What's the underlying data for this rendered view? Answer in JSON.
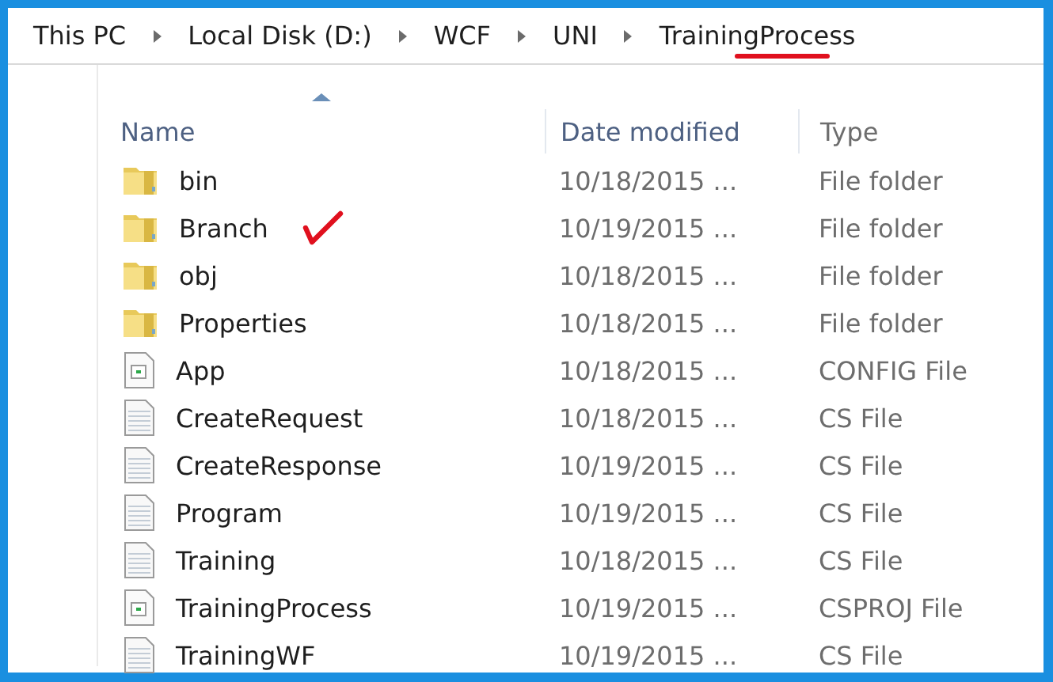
{
  "breadcrumb": [
    {
      "label": "This PC",
      "underlined": false
    },
    {
      "label": "Local Disk (D:)",
      "underlined": false
    },
    {
      "label": "WCF",
      "underlined": false
    },
    {
      "label": "UNI",
      "underlined": false
    },
    {
      "label": "TrainingProcess",
      "underlined": true
    }
  ],
  "columns": [
    {
      "label": "Name",
      "sorted": true
    },
    {
      "label": "Date modified",
      "sorted": false
    },
    {
      "label": "Type",
      "sorted": false
    }
  ],
  "files": [
    {
      "kind": "folder",
      "name": "bin",
      "date": "10/18/2015 ...",
      "type": "File folder",
      "marked": false
    },
    {
      "kind": "folder",
      "name": "Branch",
      "date": "10/19/2015 ...",
      "type": "File folder",
      "marked": true
    },
    {
      "kind": "folder",
      "name": "obj",
      "date": "10/18/2015 ...",
      "type": "File folder",
      "marked": false
    },
    {
      "kind": "folder",
      "name": "Properties",
      "date": "10/18/2015 ...",
      "type": "File folder",
      "marked": false
    },
    {
      "kind": "project",
      "name": "App",
      "date": "10/18/2015 ...",
      "type": "CONFIG File",
      "marked": false
    },
    {
      "kind": "text",
      "name": "CreateRequest",
      "date": "10/18/2015 ...",
      "type": "CS File",
      "marked": false
    },
    {
      "kind": "text",
      "name": "CreateResponse",
      "date": "10/19/2015 ...",
      "type": "CS File",
      "marked": false
    },
    {
      "kind": "text",
      "name": "Program",
      "date": "10/19/2015 ...",
      "type": "CS File",
      "marked": false
    },
    {
      "kind": "text",
      "name": "Training",
      "date": "10/18/2015 ...",
      "type": "CS File",
      "marked": false
    },
    {
      "kind": "project",
      "name": "TrainingProcess",
      "date": "10/19/2015 ...",
      "type": "CSPROJ File",
      "marked": false
    },
    {
      "kind": "text",
      "name": "TrainingWF",
      "date": "10/19/2015 ...",
      "type": "CS File",
      "marked": false
    }
  ]
}
